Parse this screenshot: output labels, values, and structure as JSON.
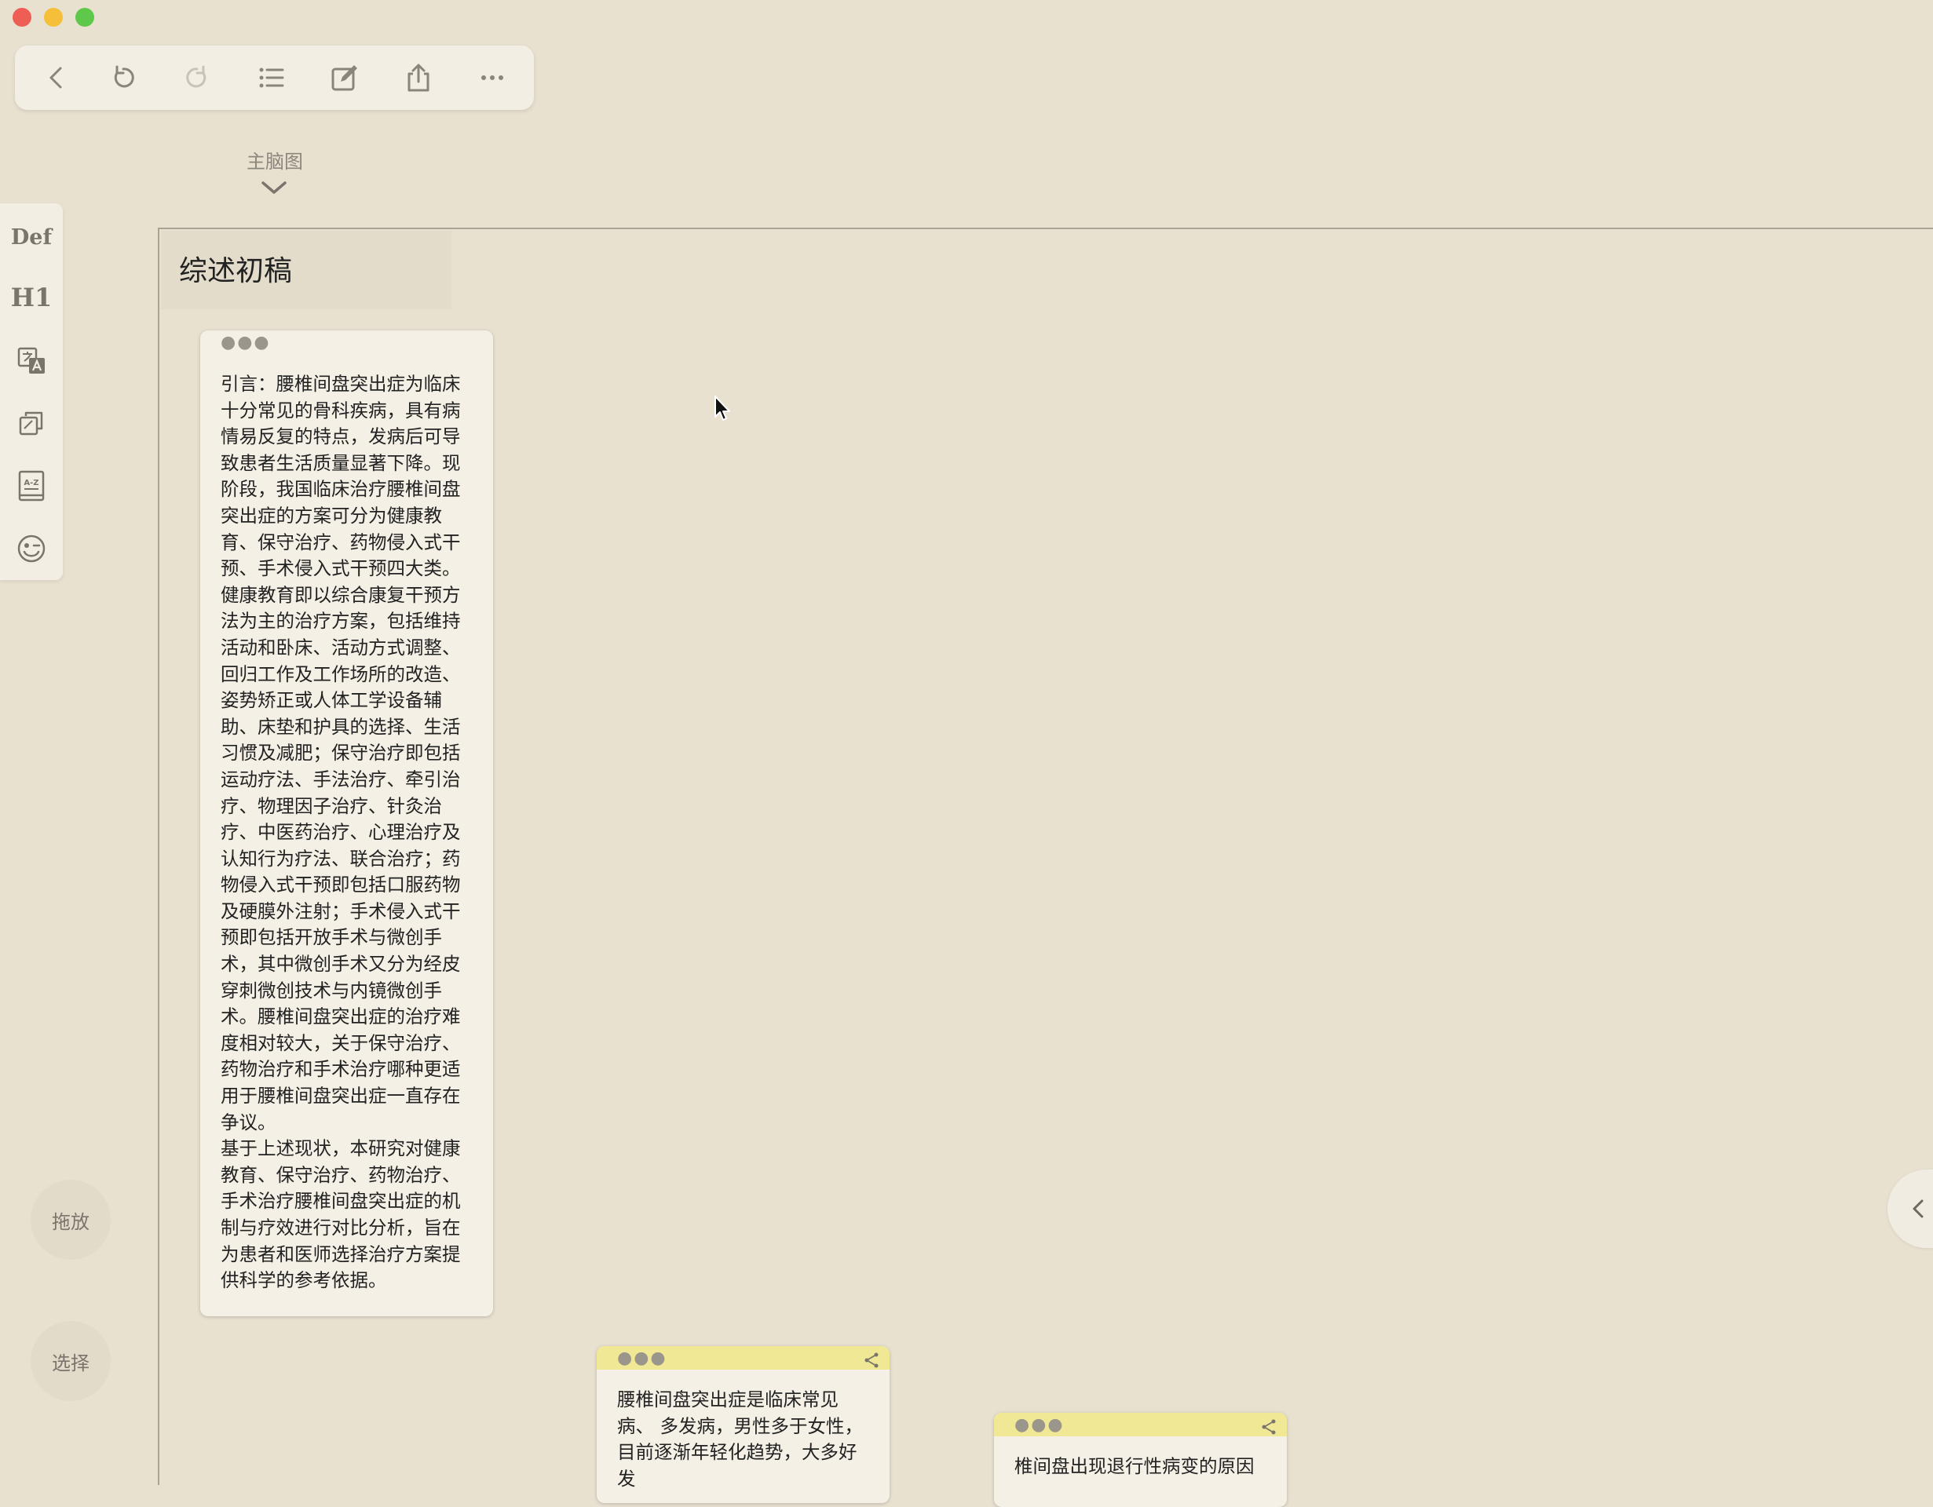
{
  "window": {
    "traffic_lights": [
      "close",
      "minimize",
      "zoom"
    ]
  },
  "toolbar": {
    "buttons": [
      {
        "icon": "back-icon"
      },
      {
        "icon": "undo-icon"
      },
      {
        "icon": "redo-icon"
      },
      {
        "icon": "list-icon"
      },
      {
        "icon": "edit-icon"
      },
      {
        "icon": "share-icon"
      },
      {
        "icon": "more-icon"
      }
    ]
  },
  "map_selector": {
    "label": "主脑图"
  },
  "sidebar": {
    "def_label": "Def",
    "h1_label": "H1",
    "icons": [
      "translate-icon",
      "copy-icon",
      "dictionary-icon",
      "emoji-icon"
    ]
  },
  "mode_buttons": {
    "drag_label": "拖放",
    "select_label": "选择"
  },
  "canvas": {
    "title": "综述初稿"
  },
  "cards": {
    "intro": {
      "text": "引言：腰椎间盘突出症为临床十分常见的骨科疾病，具有病情易反复的特点，发病后可导致患者生活质量显著下降。现阶段，我国临床治疗腰椎间盘突出症的方案可分为健康教育、保守治疗、药物侵入式干预、手术侵入式干预四大类。健康教育即以综合康复干预方法为主的治疗方案，包括维持活动和卧床、活动方式调整、回归工作及工作场所的改造、姿势矫正或人体工学设备辅助、床垫和护具的选择、生活习惯及减肥；保守治疗即包括运动疗法、手法治疗、牵引治疗、物理因子治疗、针灸治疗、中医药治疗、心理治疗及认知行为疗法、联合治疗；药物侵入式干预即包括口服药物及硬膜外注射；手术侵入式干预即包括开放手术与微创手术，其中微创手术又分为经皮穿刺微创技术与内镜微创手术。腰椎间盘突出症的治疗难度相对较大，关于保守治疗、药物治疗和手术治疗哪种更适用于腰椎间盘突出症一直存在争议。\n基于上述现状，本研究对健康教育、保守治疗、药物治疗、手术治疗腰椎间盘突出症的机制与疗效进行对比分析，旨在为患者和医师选择治疗方案提供科学的参考依据。"
    },
    "card2": {
      "text": "腰椎间盘突出症是临床常见病、 多发病，男性多于女性，目前逐渐年轻化趋势，大多好发"
    },
    "card3": {
      "text": "椎间盘出现退行性病变的原因"
    }
  },
  "colors": {
    "background": "#e8e1d0",
    "card": "#f5f0e6",
    "card_yellow_header": "#f1e895",
    "accent_gray": "#7a756c"
  }
}
